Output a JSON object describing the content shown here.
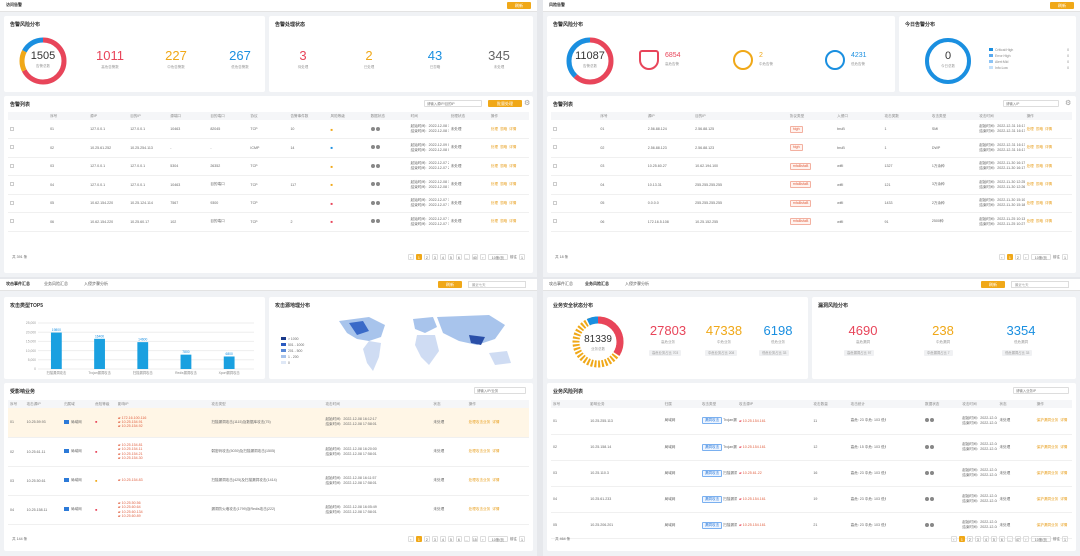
{
  "colors": {
    "accent": "#f0a818",
    "red": "#e8455a",
    "orange": "#f0a818",
    "blue": "#1a8fe0",
    "gray": "#666"
  },
  "q1": {
    "tab": "访问告警",
    "btn": "刷新",
    "dist": {
      "title": "告警风险分布",
      "total": "1505",
      "total_label": "告警总数",
      "high": "1011",
      "high_label": "高危告警数",
      "mid": "227",
      "mid_label": "中危告警数",
      "low": "267",
      "low_label": "低危告警数"
    },
    "proc": {
      "title": "告警处理状态",
      "a": "3",
      "a_label": "待处理",
      "b": "2",
      "b_label": "已处理",
      "c": "43",
      "c_label": "已忽略",
      "d": "345",
      "d_label": "未处理"
    },
    "list": {
      "title": "告警列表",
      "search": "请输入源IP/目的IP",
      "export": "批量处理",
      "headers": [
        "",
        "序号",
        "源IP",
        "目的IP",
        "源端口",
        "目的端口",
        "协议",
        "告警事件数",
        "风险等级",
        "数据状态",
        "时间",
        "处理状态",
        "操作"
      ],
      "rows": [
        [
          "",
          "01",
          "127.0.0.1",
          "127.0.0.1",
          "10463",
          "82045",
          "TCP",
          "10",
          "中",
          "",
          "起始时间：2022-12-08 16:43:40|结束时间：2022-12-08 16:44:02",
          "未处理"
        ],
        [
          "",
          "02",
          "10.25.61.252",
          "10.25.254.113",
          "-",
          "-",
          "ICMP",
          "14",
          "低",
          "",
          "起始时间：2022-12-09 09:48:22|结束时间：2022-12-08 09:43:17",
          "未处理"
        ],
        [
          "",
          "03",
          "127.0.0.1",
          "127.0.0.1",
          "5304",
          "26352",
          "TCP",
          "",
          "中",
          "",
          "起始时间：2022-12-07 20:14:22|结束时间：2022-12-07 20:15:50",
          "未处理"
        ],
        [
          "",
          "04",
          "127.0.0.1",
          "127.0.0.1",
          "10463",
          "目的端口",
          "TCP",
          "117",
          "中",
          "",
          "起始时间：2022-12-08 16:23:21|结束时间：2022-12-08 16:25:07",
          "未处理"
        ],
        [
          "",
          "05",
          "10.62.154.220",
          "10.25.124.114",
          "7567",
          "9300",
          "TCP",
          "",
          "高",
          "",
          "起始时间：2022-12-07 10:33:25|结束时间：2022-12-07 10:33:26",
          "未处理"
        ],
        [
          "",
          "06",
          "10.62.154.220",
          "10.25.60.17",
          "102",
          "目的端口",
          "TCP",
          "2",
          "高",
          "",
          "起始时间：2022-12-07 10:37:44|结束时间：2022-12-07 10:37:47",
          "未处理"
        ]
      ],
      "ops": [
        "处理",
        "忽略",
        "详情"
      ],
      "total": "共 391 条",
      "pages": [
        "1",
        "2",
        "3",
        "4",
        "5",
        "6",
        "...",
        "40"
      ],
      "size": "10条/页",
      "goto": "前往",
      "pgnum": "1",
      "pgunit": "页"
    }
  },
  "q2": {
    "tab": "风险告警",
    "btn": "刷新",
    "dist": {
      "title": "告警风险分布",
      "total": "11087",
      "total_label": "告警总数",
      "high": "6854",
      "high_label": "高危告警",
      "mid": "2",
      "mid_label": "中危告警",
      "low": "4231",
      "low_label": "低危告警"
    },
    "today": {
      "title": "今日告警分布",
      "total": "0",
      "total_label": "今日总数",
      "legend": [
        {
          "k": "Critical:High",
          "v": "0"
        },
        {
          "k": "Error:High",
          "v": "0"
        },
        {
          "k": "Alert:Mid",
          "v": "0"
        },
        {
          "k": "Info:Low",
          "v": "0"
        }
      ]
    },
    "list": {
      "title": "告警列表",
      "search": "请输入IP",
      "headers": [
        "",
        "序号",
        "源IP",
        "目的IP",
        "",
        "协议类型",
        "入侵口",
        "攻击类数",
        "攻击类型",
        "攻击时间",
        "操作"
      ],
      "rows": [
        [
          "",
          "01",
          "2.56.88.124",
          "2.56.88.125",
          "",
          "high",
          "bruB",
          "1",
          "SMI",
          "起始时间：2022-12-31 16:17:24|结束时间：2022-12-31 16:17:24"
        ],
        [
          "",
          "02",
          "2.56.88.123",
          "2.56.88.123",
          "",
          "high",
          "bruB",
          "1",
          "DWP",
          "起始时间：2022-12-31 16:17:01|结束时间：2022-12-31 16:17:01"
        ],
        [
          "",
          "03",
          "10.25.60.27",
          "10.62.194.100",
          "",
          "mfaBsfaB",
          "wifiI",
          "1327",
          "1万余种",
          "起始时间：2022-11-30 16:17:09|结束时间：2022-11-30 16:17:09"
        ],
        [
          "",
          "04",
          "10.13.31",
          "255.255.255.255",
          "",
          "mfaBsfaB",
          "wifiI",
          "121",
          "3万余种",
          "起始时间：2022-11-30 12:25:25|结束时间：2022-11-30 12:26:25"
        ],
        [
          "",
          "05",
          "0.0.0.0",
          "255.255.255.255",
          "",
          "mfaBsfaB",
          "wifiI",
          "1433",
          "2万余种",
          "起始时间：2022-11-30 15:10:22|结束时间：2022-11-30 15:18:22"
        ],
        [
          "",
          "06",
          "172.16.5.108",
          "10.25.152.255",
          "",
          "mfaBsfaB",
          "wifiI",
          "91",
          "2500种",
          "起始时间：2022-11-25 10:13:51|结束时间：2022-11-25 10:27:08"
        ]
      ],
      "ops": [
        "处理",
        "忽略",
        "详情"
      ],
      "total": "共 18 条",
      "pages": [
        "1",
        "2"
      ],
      "size": "10条/页",
      "goto": "前往",
      "pgnum": "1"
    }
  },
  "q3": {
    "tabs": [
      "攻击事件汇总",
      "业务风险汇总",
      "入侵步骤分析"
    ],
    "btn": "刷新",
    "date": "最近七天",
    "top5": {
      "title": "攻击类型TOP5",
      "yticks": [
        "25,000",
        "20,000",
        "15,000",
        "10,000",
        "5,000",
        "0"
      ]
    },
    "map": {
      "title": "攻击源地理分布",
      "legend": [
        "> 1000",
        "501 - 1000",
        "201 - 500",
        "1 - 200",
        "0"
      ]
    },
    "list": {
      "title": "受影响业务",
      "search": "请输入IP/业务",
      "headers": [
        "序号",
        "攻击源IP",
        "归属域",
        "危险等级",
        "影响IP",
        "攻击类型",
        "攻击时间",
        "状态",
        "操作"
      ],
      "rows": [
        [
          "01",
          "10.25.59.93",
          "局域网",
          "高",
          "172.16.100.116|10.25.154.91|10.25.154.92",
          "扫描漏洞攻击(1115)及数据库攻击(75)",
          "起始时间：2022-12-08 16:12:17|结束时间：2022-12-08 17:58:01",
          "未处理"
        ],
        [
          "02",
          "10.25.61.11",
          "局域网",
          "高",
          "10.25.154.81|10.25.154.11|10.25.154.21|10.25.154.30",
          "弱密码攻击(5039)及扫描漏洞攻击(1505)",
          "起始时间：2022-12-08 16:20:00|结束时间：2022-12-08 17:58:01",
          "未处理"
        ],
        [
          "03",
          "10.25.50.61",
          "局域网",
          "中",
          "10.25.154.83",
          "扫描漏洞攻击(425)及扫描漏洞攻击(1414)",
          "起始时间：2022-12-08 16:11:57|结束时间：2022-12-08 17:58:01",
          "未处理"
        ],
        [
          "04",
          "10.25.158.11",
          "局域网",
          "高",
          "10.25.50.56|10.25.60.64|10.25.60.134|10.25.60.89",
          "漏洞防火墙攻击(1799)及Redis攻击(222)",
          "起始时间：2022-12-08 16:05:49|结束时间：2022-12-08 17:58:01",
          "未处理"
        ]
      ],
      "ops": [
        "处理攻击业务",
        "详情"
      ],
      "total": "共 144 条",
      "pages": [
        "1",
        "2",
        "3",
        "4",
        "5",
        "6",
        "...",
        "15"
      ],
      "size": "10条/页",
      "goto": "前往",
      "pgnum": "1"
    }
  },
  "chart_data": {
    "type": "bar",
    "categories": [
      "扫描漏洞攻击",
      "Trojan漏洞攻击",
      "扫描漏洞攻击",
      "Redis漏洞攻击",
      "Xport漏洞攻击"
    ],
    "values": [
      19800,
      16400,
      14600,
      7800,
      6800
    ],
    "value_labels": [
      "19800",
      "16400",
      "14600",
      "7800",
      "6800"
    ],
    "ylim": [
      0,
      25000
    ]
  },
  "q4": {
    "tabs": [
      "攻击事件汇总",
      "业务风险汇总",
      "入侵步骤分析"
    ],
    "btn": "刷新",
    "date": "最近七天",
    "safe": {
      "title": "业务安全状态分布",
      "total": "81339",
      "total_label": "业务总数",
      "high": "27803",
      "high_label": "高危业务",
      "mid": "47338",
      "mid_label": "中危业务",
      "low": "6198",
      "low_label": "低危业务",
      "high_chip": "高危业务占比 703",
      "mid_chip": "中危业务占比 208",
      "low_chip": "低危业务占比 33"
    },
    "risk": {
      "title": "漏洞风险分布",
      "high": "4690",
      "high_label": "高危漏洞",
      "mid": "238",
      "mid_label": "中危漏洞",
      "low": "3354",
      "low_label": "低危漏洞",
      "high_chip": "高危漏洞占比 97",
      "mid_chip": "中危漏洞占比 7",
      "low_chip": "低危漏洞占比 33"
    },
    "list": {
      "title": "业务风险列表",
      "search": "请输入业务IP",
      "headers": [
        "序号",
        "影响业务",
        "",
        "归属",
        "攻击类型",
        "攻击源IP",
        "",
        "攻击数量",
        "攻击统计",
        "",
        "数据状态",
        "攻击时间",
        "状态",
        "操作"
      ],
      "rows": [
        [
          "01",
          "10.25.255.113",
          "",
          "局域网",
          "Trojan漏洞攻击",
          "10.25.154.161",
          "",
          "11",
          "高危: 23 中危: 103 低危: 4",
          "",
          "",
          "起始时间：2022-12-08 19:09:59|结束时间：2022-12-08 19:09:59",
          "未处理"
        ],
        [
          "02",
          "10.25.158.14",
          "",
          "局域网",
          "Trojan漏洞攻击",
          "10.25.154.161",
          "",
          "12",
          "高危: 15 中危: 103 低危: 4",
          "",
          "",
          "起始时间：2022-12-08 19:09:47|结束时间：2022-12-08 19:09:47",
          "未处理"
        ],
        [
          "03",
          "10.25.110.3",
          "",
          "局域网",
          "扫描漏洞攻击",
          "10.25.61.22",
          "",
          "16",
          "高危: 23 中危: 103 低危: 4",
          "",
          "",
          "起始时间：2022-12-08 18:56:46|结束时间：2022-12-08 18:56:46",
          "未处理"
        ],
        [
          "04",
          "10.25.61.233",
          "",
          "局域网",
          "扫描漏洞攻击",
          "10.25.154.161",
          "",
          "19",
          "高危: 23 中危: 103 低危: 4",
          "",
          "",
          "起始时间：2022-12-08 18:56:56|结束时间：2022-12-08 18:56:56",
          "未处理"
        ],
        [
          "05",
          "10.25.206.201",
          "",
          "局域网",
          "扫描漏洞攻击",
          "10.25.154.161",
          "",
          "21",
          "高危: 23 中危: 103 低危: 4",
          "",
          "",
          "起始时间：2022-12-08 18:56:24|结束时间：2022-12-08 18:56:24",
          "未处理"
        ]
      ],
      "ops": [
        "保护漏洞业务",
        "详情"
      ],
      "total": "共 464 条",
      "pages": [
        "1",
        "2",
        "3",
        "4",
        "5",
        "6",
        "...",
        "47"
      ],
      "size": "10条/页",
      "goto": "前往",
      "pgnum": "1"
    }
  }
}
